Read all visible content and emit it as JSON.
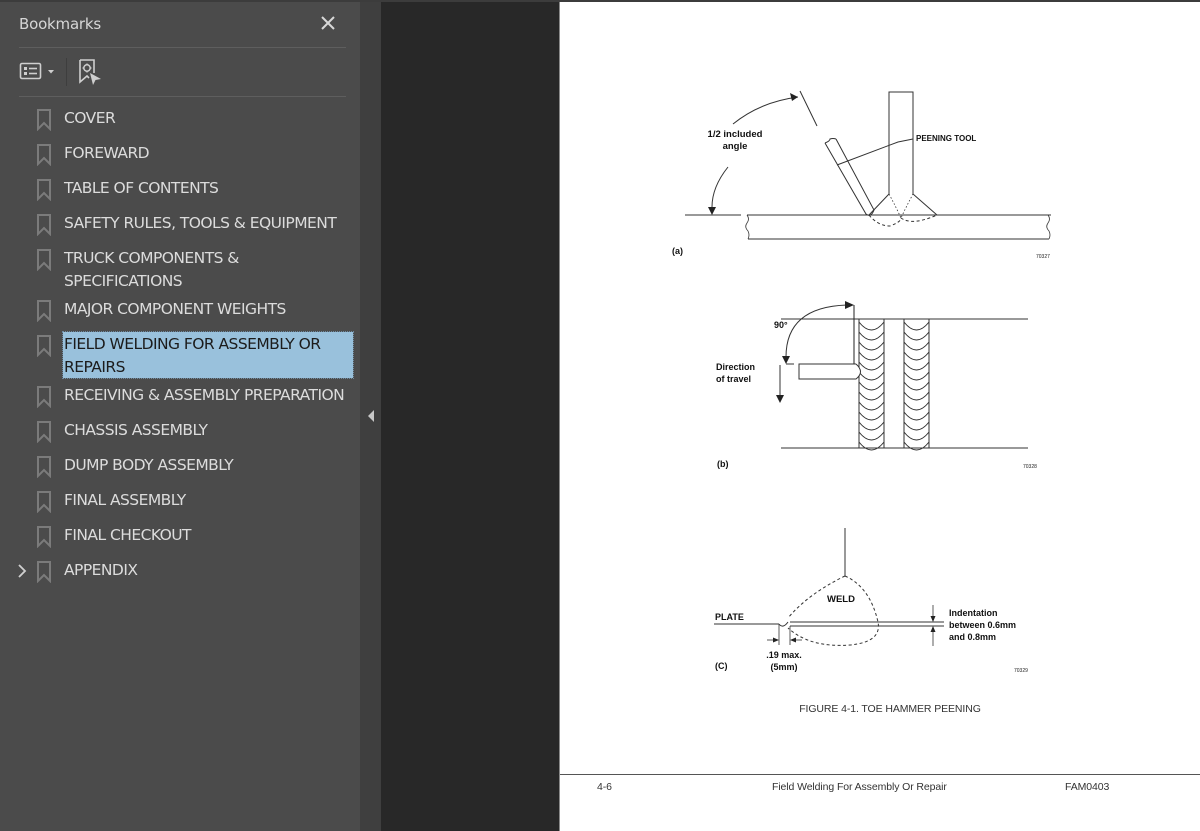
{
  "bookmarks_panel": {
    "title": "Bookmarks",
    "close_icon": "close-icon",
    "options_icon": "list-options-icon",
    "find_icon": "find-current-bookmark-icon",
    "collapse_icon": "collapse-left-triangle-icon",
    "items": [
      {
        "label": "COVER",
        "selected": false,
        "expandable": false
      },
      {
        "label": "FOREWARD",
        "selected": false,
        "expandable": false
      },
      {
        "label": "TABLE OF CONTENTS",
        "selected": false,
        "expandable": false
      },
      {
        "label": "SAFETY RULES, TOOLS & EQUIPMENT",
        "selected": false,
        "expandable": false
      },
      {
        "label": "TRUCK COMPONENTS & SPECIFICATIONS",
        "selected": false,
        "expandable": false
      },
      {
        "label": "MAJOR COMPONENT WEIGHTS",
        "selected": false,
        "expandable": false
      },
      {
        "label": "FIELD WELDING FOR ASSEMBLY OR REPAIRS",
        "selected": true,
        "expandable": false
      },
      {
        "label": "RECEIVING & ASSEMBLY PREPARATION",
        "selected": false,
        "expandable": false
      },
      {
        "label": "CHASSIS ASSEMBLY",
        "selected": false,
        "expandable": false
      },
      {
        "label": "DUMP BODY ASSEMBLY",
        "selected": false,
        "expandable": false
      },
      {
        "label": "FINAL ASSEMBLY",
        "selected": false,
        "expandable": false
      },
      {
        "label": "FINAL CHECKOUT",
        "selected": false,
        "expandable": false
      },
      {
        "label": "APPENDIX",
        "selected": false,
        "expandable": true
      }
    ]
  },
  "document": {
    "figure_a": {
      "label": "(a)",
      "angle_label_1": "1/2 included",
      "angle_label_2": "angle",
      "tool_label": "PEENING TOOL",
      "ref": "70327"
    },
    "figure_b": {
      "label": "(b)",
      "angle_label": "90°",
      "direction_label_1": "Direction",
      "direction_label_2": "of travel",
      "ref": "70328"
    },
    "figure_c": {
      "label": "(C)",
      "weld_label": "WELD",
      "plate_label": "PLATE",
      "max_label_1": ".19 max.",
      "max_label_2": "(5mm)",
      "indent_label_1": "Indentation",
      "indent_label_2": "between 0.6mm",
      "indent_label_3": "and 0.8mm",
      "ref": "70329"
    },
    "caption": "FIGURE 4-1. TOE HAMMER PEENING",
    "footer": {
      "page_number": "4-6",
      "section_title": "Field Welding For Assembly Or Repair",
      "doc_code": "FAM0403"
    }
  },
  "colors": {
    "panel_bg": "#4b4b4b",
    "selection": "#99c1dc",
    "viewport_bg": "#282828"
  }
}
